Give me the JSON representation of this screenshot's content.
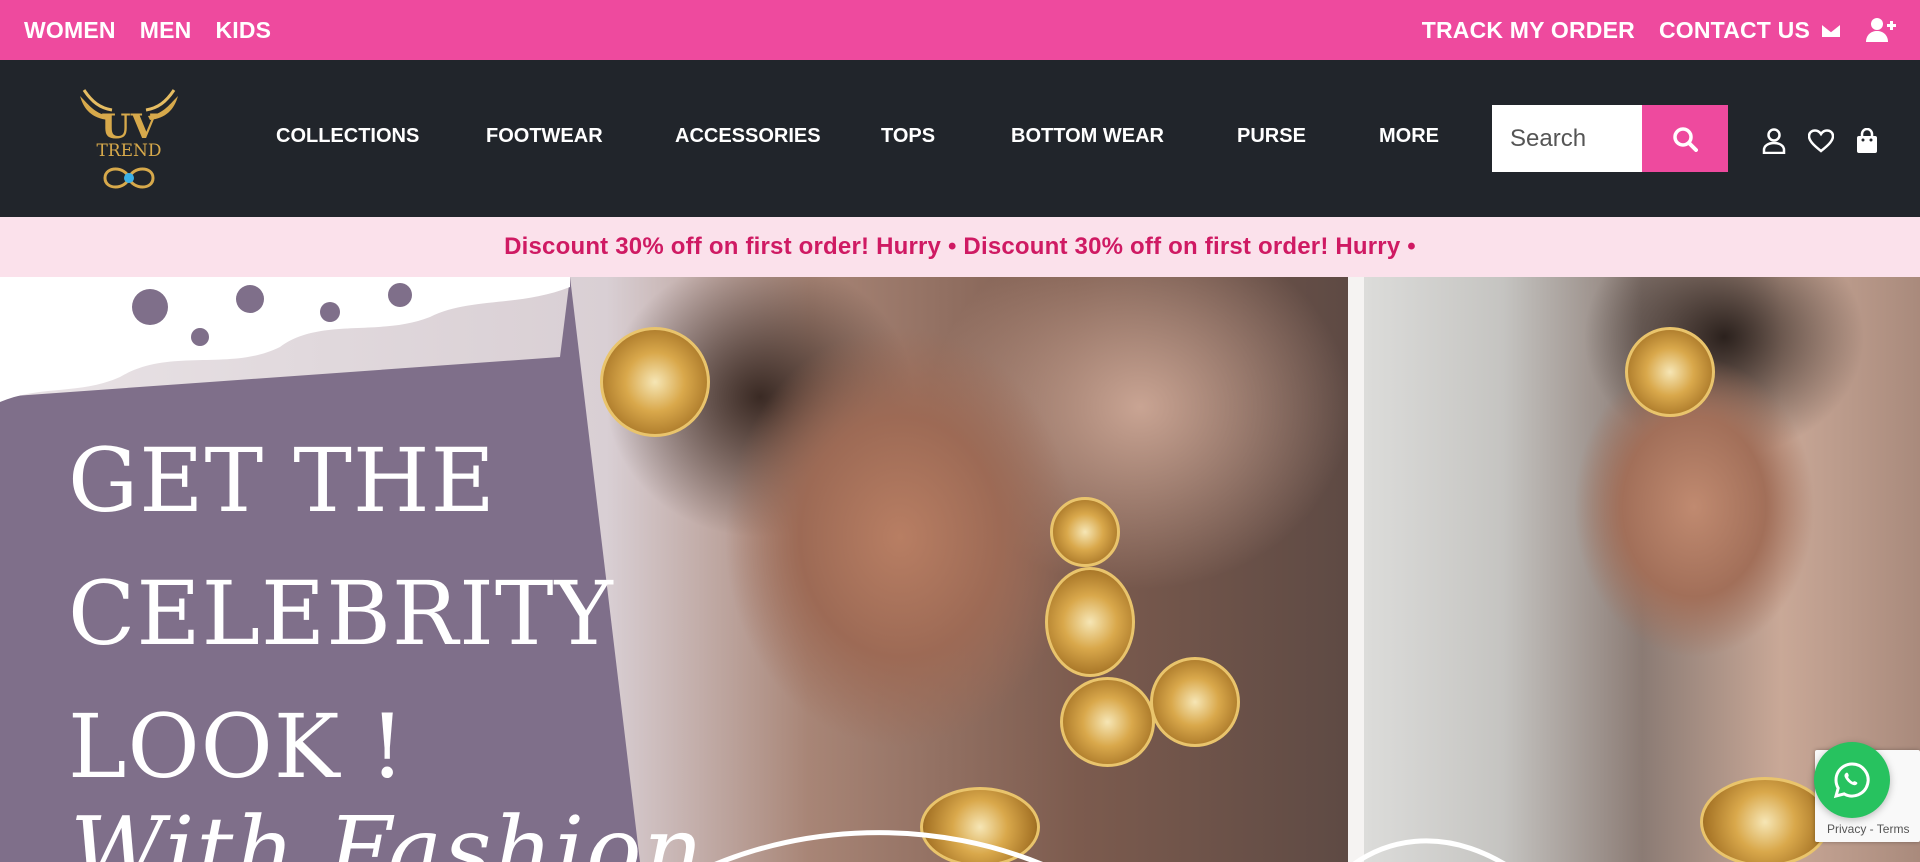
{
  "topbar": {
    "left_links": [
      "WOMEN",
      "MEN",
      "KIDS"
    ],
    "track_order": "TRACK MY ORDER",
    "contact_us": "CONTACT US",
    "bg_color": "#ee4a9e",
    "icons": [
      "envelope-icon",
      "user-plus-icon"
    ]
  },
  "nav": {
    "logo_top": "UV",
    "logo_bottom": "TREND",
    "links": [
      "COLLECTIONS",
      "FOOTWEAR",
      "ACCESSORIES",
      "TOPS",
      "BOTTOM WEAR",
      "PURSE",
      "MORE"
    ],
    "search_placeholder": "Search",
    "icons": [
      "search-icon",
      "user-icon",
      "heart-icon",
      "shopping-bag-icon"
    ],
    "bg_color": "#21252b"
  },
  "discount": {
    "text": "Discount 30% off on first order! Hurry • Discount 30% off on first order! Hurry •",
    "color": "#cf1a63"
  },
  "hero": {
    "line1": "GET THE",
    "line2": "CELEBRITY",
    "line3": "LOOK !",
    "script": "With Fashion"
  },
  "floating": {
    "whatsapp_icon": "whatsapp-icon",
    "recaptcha_terms": "Privacy - Terms"
  }
}
